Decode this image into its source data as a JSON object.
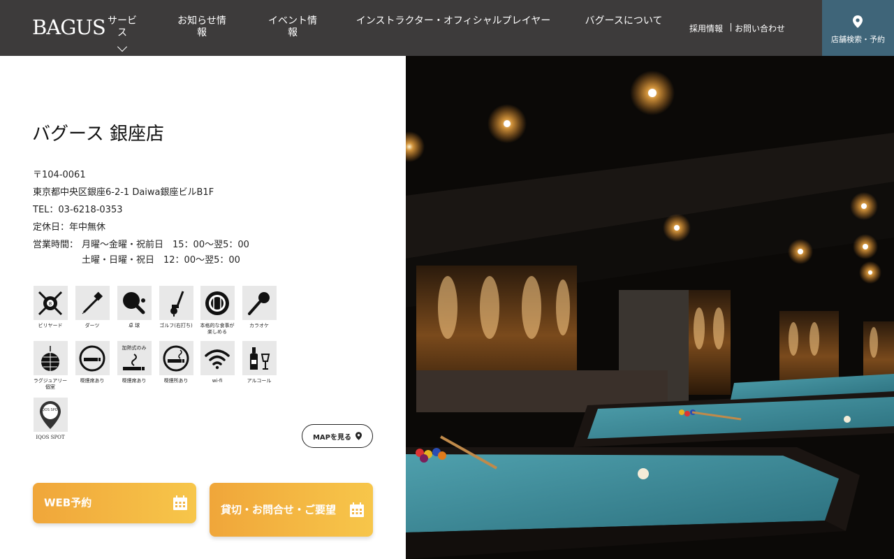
{
  "header": {
    "logo": "BAGUS",
    "nav": {
      "services": "サービス",
      "news": "お知らせ情報",
      "events": "イベント情報",
      "instructor": "インストラクター・オフィシャルプレイヤー",
      "about": "バグースについて",
      "recruit": "採用情報",
      "contact": "お問い合わせ"
    },
    "store_search": "店舗検索・予約"
  },
  "store": {
    "title": "バグース 銀座店",
    "postal": "〒104-0061",
    "address": "東京都中央区銀座6-2-1 Daiwa銀座ビルB1F",
    "tel": "TEL：03-6218-0353",
    "closed": "定休日：年中無休",
    "hours_label": "営業時間：",
    "hours_weekday": "月曜～金曜・祝前日　15：00～翌5：00",
    "hours_weekend": "土曜・日曜・祝日　12：00～翌5：00"
  },
  "amenities": [
    {
      "icon": "billiards-icon",
      "label": "ビリヤード"
    },
    {
      "icon": "darts-icon",
      "label": "ダーツ"
    },
    {
      "icon": "table-tennis-icon",
      "label": "卓 球"
    },
    {
      "icon": "golf-icon",
      "label": "ゴルフ(右打ち)"
    },
    {
      "icon": "dining-icon",
      "label": "本格的な食事が楽しめる"
    },
    {
      "icon": "karaoke-icon",
      "label": "カラオケ"
    },
    {
      "icon": "luxury-room-icon",
      "label": "ラグジュアリー個室"
    },
    {
      "icon": "smoking-seat-icon",
      "label": "喫煙席あり"
    },
    {
      "icon": "heated-tobacco-icon",
      "label": "喫煙席あり",
      "tag": "加熱式のみ"
    },
    {
      "icon": "smoking-area-icon",
      "label": "喫煙所あり"
    },
    {
      "icon": "wifi-icon",
      "label": "wi-fi"
    },
    {
      "icon": "alcohol-icon",
      "label": "アルコール"
    },
    {
      "icon": "iqos-spot-icon",
      "label": "IQOS SPOT",
      "tag": "IQOS SPOT"
    }
  ],
  "map_button": "MAPを見る",
  "cta": {
    "web": "WEB予約",
    "contact": "貸切・お問合せ・ご要望"
  },
  "colors": {
    "header_bg": "#3d3b3b",
    "store_btn_bg": "#3f6579",
    "cta_gradient_start": "#f0a63a",
    "cta_gradient_end": "#f7c64a"
  }
}
